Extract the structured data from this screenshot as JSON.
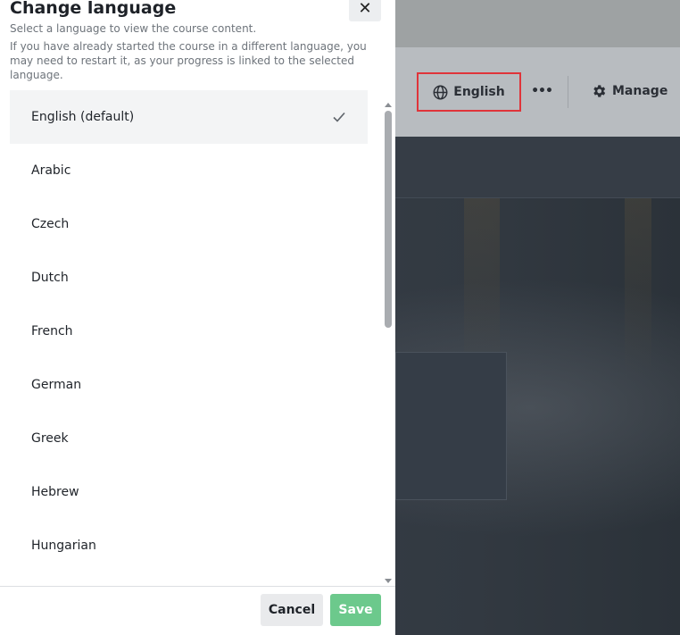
{
  "header": {
    "language_label": "English",
    "more_label": "•••",
    "manage_label": "Manage"
  },
  "modal": {
    "title": "Change language",
    "close_label": "✕",
    "subtitle": "Select a language to view the course content.",
    "description": "If you have already started the course in a different language, you may need to restart it, as your progress is linked to the selected language.",
    "languages": [
      {
        "label": "English (default)",
        "selected": true
      },
      {
        "label": "Arabic",
        "selected": false
      },
      {
        "label": "Czech",
        "selected": false
      },
      {
        "label": "Dutch",
        "selected": false
      },
      {
        "label": "French",
        "selected": false
      },
      {
        "label": "German",
        "selected": false
      },
      {
        "label": "Greek",
        "selected": false
      },
      {
        "label": "Hebrew",
        "selected": false
      },
      {
        "label": "Hungarian",
        "selected": false
      }
    ],
    "cancel_label": "Cancel",
    "save_label": "Save"
  },
  "colors": {
    "accent_save": "#6cc98c",
    "highlight_border": "#e0343a"
  }
}
